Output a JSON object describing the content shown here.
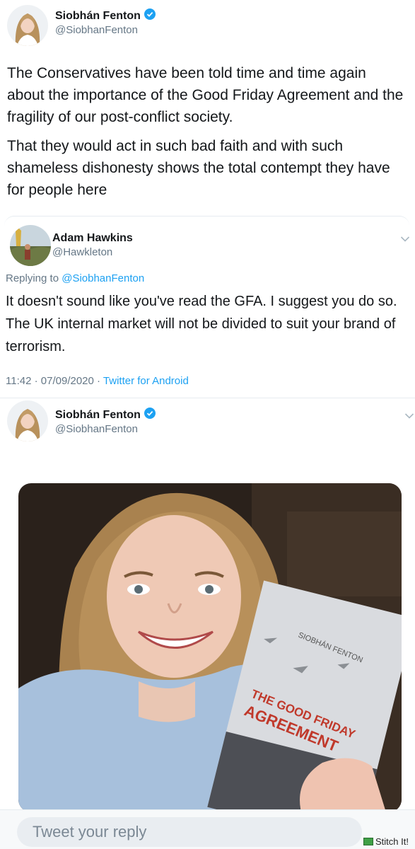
{
  "tweet1": {
    "display_name": "Siobhán Fenton",
    "handle": "@SiobhanFenton",
    "paragraphs": [
      "The Conservatives have been told time and time again about the importance of the Good Friday Agreement and the fragility of our post-conflict society.",
      "That they would act in such bad faith and with such shameless dishonesty shows the total contempt they have for people here"
    ]
  },
  "reply": {
    "display_name": "Adam Hawkins",
    "handle": "@Hawkleton",
    "replying_prefix": "Replying to ",
    "replying_to": "@SiobhanFenton",
    "body": "It doesn't sound like you've read the GFA. I suggest you do so. The UK internal market will not be divided to suit your brand of terrorism.",
    "time": "11:42",
    "date": "07/09/2020",
    "separator": " · ",
    "client": "Twitter for Android"
  },
  "tweet3": {
    "display_name": "Siobhán Fenton",
    "handle": "@SiobhanFenton",
    "photo": {
      "book_author": "SIOBHÁN FENTON",
      "book_title_line1": "THE GOOD FRIDAY",
      "book_title_line2": "AGREEMENT"
    }
  },
  "reply_bar": {
    "placeholder": "Tweet your reply",
    "watermark": "Stitch It!"
  },
  "icons": {
    "verified": "verified-badge-icon",
    "chevron": "chevron-down-icon"
  },
  "colors": {
    "link": "#1da1f2",
    "muted": "#657786",
    "text": "#14171a",
    "verified": "#1da1f2"
  }
}
